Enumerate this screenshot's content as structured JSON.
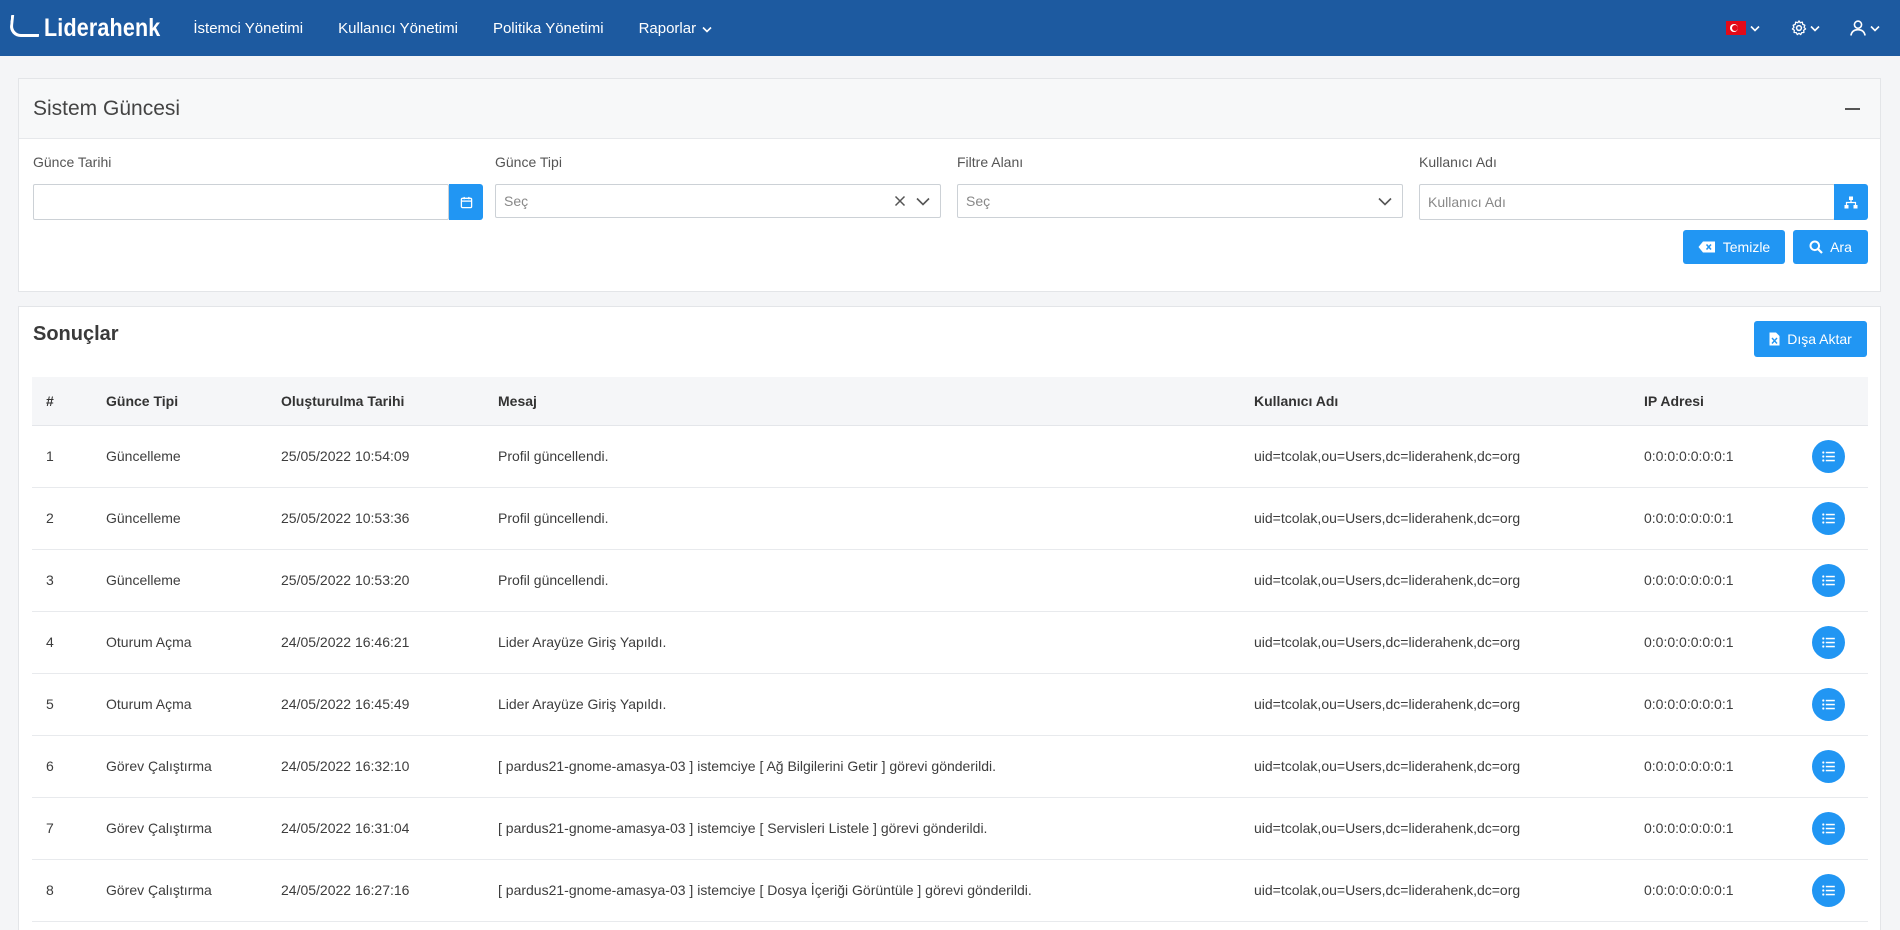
{
  "brand": {
    "name": "Liderahenk"
  },
  "nav": {
    "items": [
      {
        "label": "İstemci Yönetimi"
      },
      {
        "label": "Kullanıcı Yönetimi"
      },
      {
        "label": "Politika Yönetimi"
      },
      {
        "label": "Raporlar"
      }
    ]
  },
  "filter": {
    "title": "Sistem Güncesi",
    "date": {
      "label": "Günce Tarihi",
      "value": ""
    },
    "type": {
      "label": "Günce Tipi",
      "value": "Seç"
    },
    "area": {
      "label": "Filtre Alanı",
      "value": "Seç"
    },
    "user": {
      "label": "Kullanıcı Adı",
      "placeholder": "Kullanıcı Adı"
    },
    "clear_label": "Temizle",
    "search_label": "Ara"
  },
  "results": {
    "title": "Sonuçlar",
    "export_label": "Dışa Aktar",
    "columns": [
      "#",
      "Günce Tipi",
      "Oluşturulma Tarihi",
      "Mesaj",
      "Kullanıcı Adı",
      "IP Adresi"
    ],
    "rows": [
      {
        "n": "1",
        "type": "Güncelleme",
        "date": "25/05/2022 10:54:09",
        "message": "Profil güncellendi.",
        "user": "uid=tcolak,ou=Users,dc=liderahenk,dc=org",
        "ip": "0:0:0:0:0:0:0:1"
      },
      {
        "n": "2",
        "type": "Güncelleme",
        "date": "25/05/2022 10:53:36",
        "message": "Profil güncellendi.",
        "user": "uid=tcolak,ou=Users,dc=liderahenk,dc=org",
        "ip": "0:0:0:0:0:0:0:1"
      },
      {
        "n": "3",
        "type": "Güncelleme",
        "date": "25/05/2022 10:53:20",
        "message": "Profil güncellendi.",
        "user": "uid=tcolak,ou=Users,dc=liderahenk,dc=org",
        "ip": "0:0:0:0:0:0:0:1"
      },
      {
        "n": "4",
        "type": "Oturum Açma",
        "date": "24/05/2022 16:46:21",
        "message": "Lider Arayüze Giriş Yapıldı.",
        "user": "uid=tcolak,ou=Users,dc=liderahenk,dc=org",
        "ip": "0:0:0:0:0:0:0:1"
      },
      {
        "n": "5",
        "type": "Oturum Açma",
        "date": "24/05/2022 16:45:49",
        "message": "Lider Arayüze Giriş Yapıldı.",
        "user": "uid=tcolak,ou=Users,dc=liderahenk,dc=org",
        "ip": "0:0:0:0:0:0:0:1"
      },
      {
        "n": "6",
        "type": "Görev Çalıştırma",
        "date": "24/05/2022 16:32:10",
        "message": "[ pardus21-gnome-amasya-03 ] istemciye [ Ağ Bilgilerini Getir ] görevi gönderildi.",
        "user": "uid=tcolak,ou=Users,dc=liderahenk,dc=org",
        "ip": "0:0:0:0:0:0:0:1"
      },
      {
        "n": "7",
        "type": "Görev Çalıştırma",
        "date": "24/05/2022 16:31:04",
        "message": "[ pardus21-gnome-amasya-03 ] istemciye [ Servisleri Listele ] görevi gönderildi.",
        "user": "uid=tcolak,ou=Users,dc=liderahenk,dc=org",
        "ip": "0:0:0:0:0:0:0:1"
      },
      {
        "n": "8",
        "type": "Görev Çalıştırma",
        "date": "24/05/2022 16:27:16",
        "message": "[ pardus21-gnome-amasya-03 ] istemciye [ Dosya İçeriği Görüntüle ] görevi gönderildi.",
        "user": "uid=tcolak,ou=Users,dc=liderahenk,dc=org",
        "ip": "0:0:0:0:0:0:0:1"
      }
    ]
  }
}
